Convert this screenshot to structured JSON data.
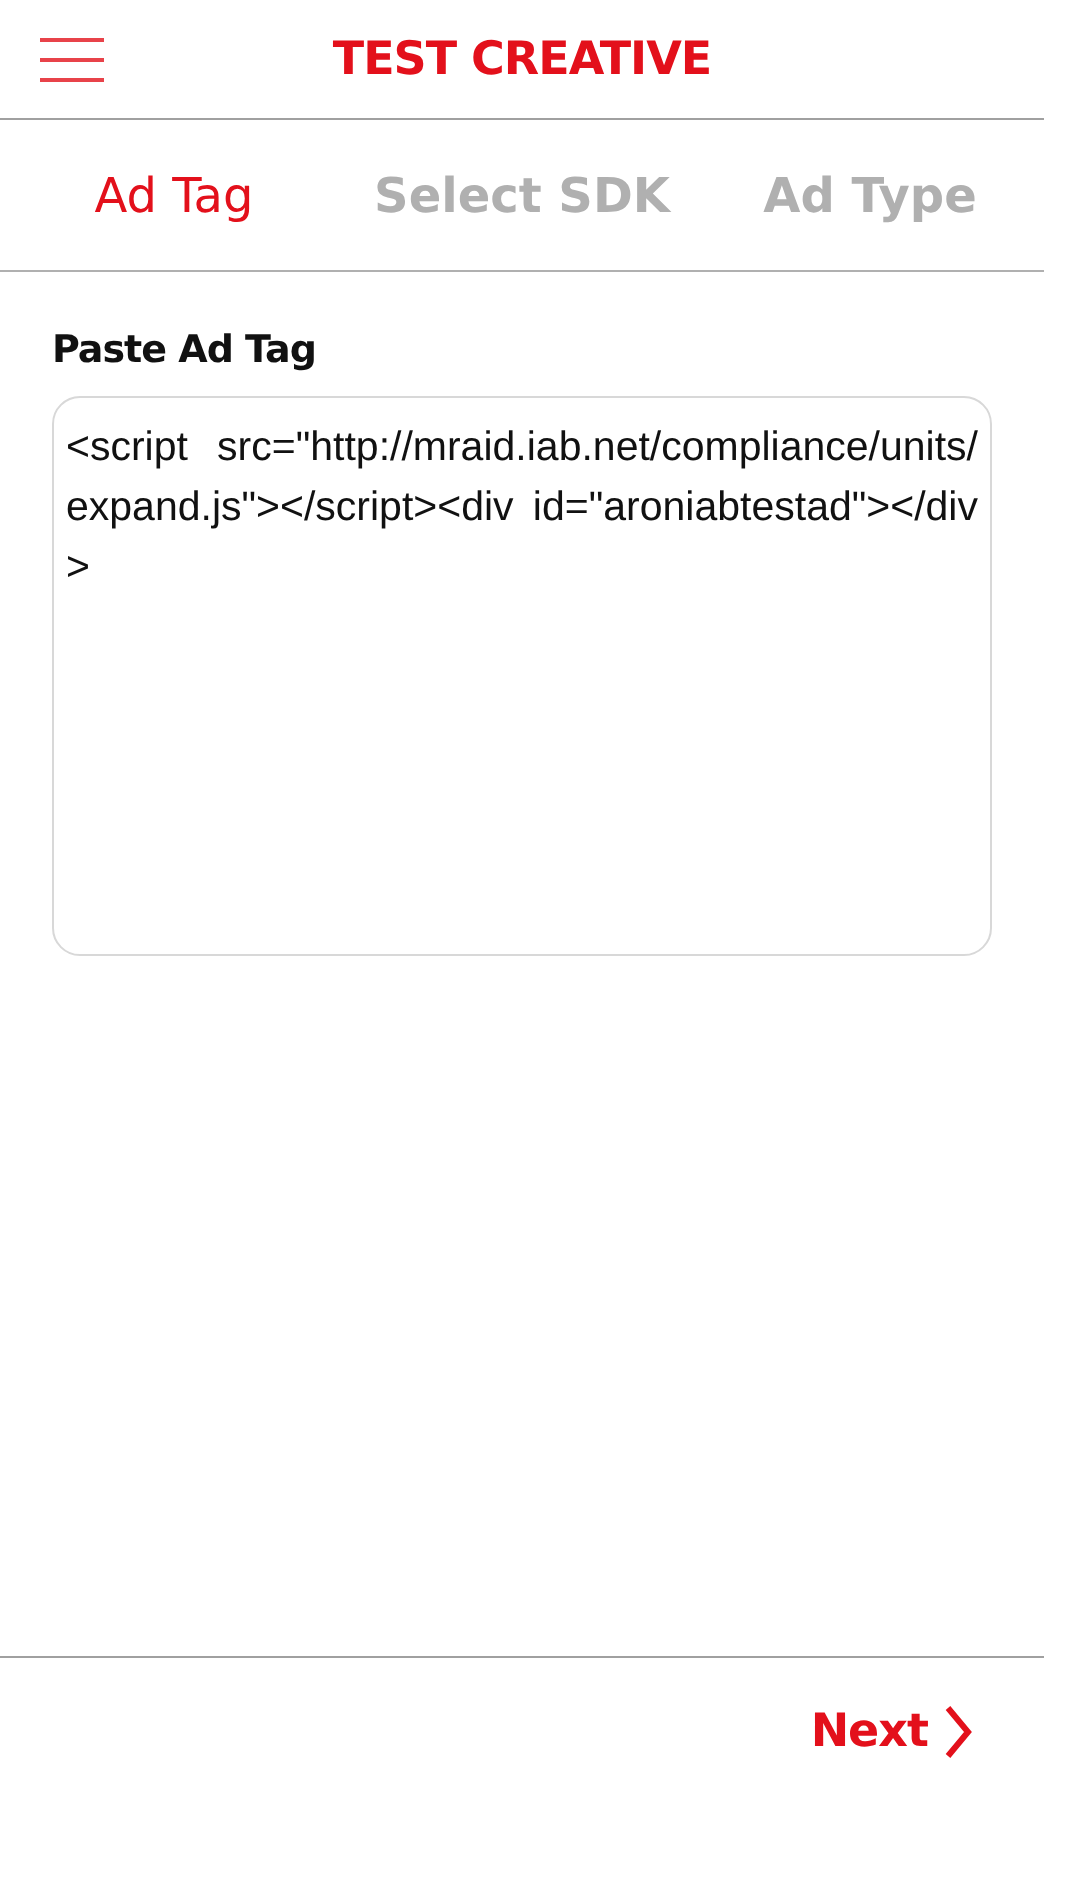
{
  "header": {
    "title": "TEST CREATIVE"
  },
  "tabs": [
    {
      "label": "Ad Tag",
      "selected": true
    },
    {
      "label": "Select SDK",
      "selected": false
    },
    {
      "label": "Ad Type",
      "selected": false
    }
  ],
  "ad_tag": {
    "label": "Paste Ad Tag",
    "value": "<script src=\"http://mraid.iab.net/compliance/units/expand.js\"></script><div id=\"aroniabtestad\"></div>"
  },
  "footer": {
    "next_label": "Next"
  }
}
